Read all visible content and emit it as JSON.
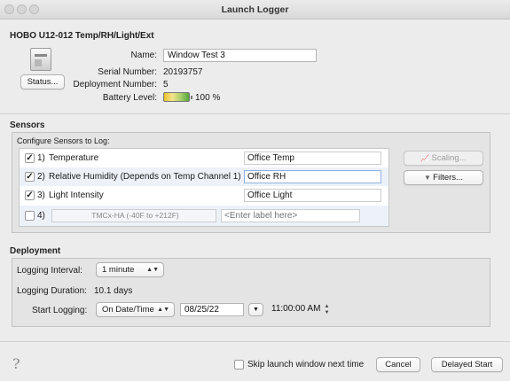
{
  "window": {
    "title": "Launch Logger"
  },
  "device": {
    "model": "HOBO U12-012 Temp/RH/Light/Ext",
    "status_button": "Status...",
    "name_label": "Name:",
    "name_value": "Window Test 3",
    "serial_label": "Serial Number:",
    "serial_value": "20193757",
    "deployment_label": "Deployment Number:",
    "deployment_value": "5",
    "battery_label": "Battery Level:",
    "battery_value": "100 %",
    "battery_fraction": 1.0
  },
  "sensors": {
    "title": "Sensors",
    "configure_label": "Configure Sensors to Log:",
    "rows": [
      {
        "checked": true,
        "checkmark": "✓",
        "number": "1)",
        "name": "Temperature",
        "label": "Office Temp"
      },
      {
        "checked": true,
        "checkmark": "✓",
        "number": "2)",
        "name": "Relative Humidity (Depends on Temp Channel 1)",
        "label": "Office RH"
      },
      {
        "checked": true,
        "checkmark": "✓",
        "number": "3)",
        "name": "Light Intensity",
        "label": "Office Light"
      },
      {
        "checked": false,
        "checkmark": "",
        "number": "4)",
        "name": "TMCx-HA (-40F to +212F)",
        "label": "",
        "placeholder": "<Enter label here>"
      }
    ],
    "scaling_button": "Scaling...",
    "filters_button": "Filters..."
  },
  "deployment": {
    "title": "Deployment",
    "interval_label": "Logging Interval:",
    "interval_value": "1 minute",
    "duration_label": "Logging Duration:",
    "duration_value": "10.1 days",
    "start_label": "Start Logging:",
    "start_mode": "On Date/Time",
    "start_date": "08/25/22",
    "start_time": "11:00:00 AM"
  },
  "footer": {
    "help": "?",
    "skip_label": "Skip launch window next time",
    "cancel_button": "Cancel",
    "launch_button": "Delayed Start"
  },
  "colors": {
    "background": "#ececec",
    "panel": "#e4e4e4",
    "row_highlight": "#edf1f8"
  }
}
